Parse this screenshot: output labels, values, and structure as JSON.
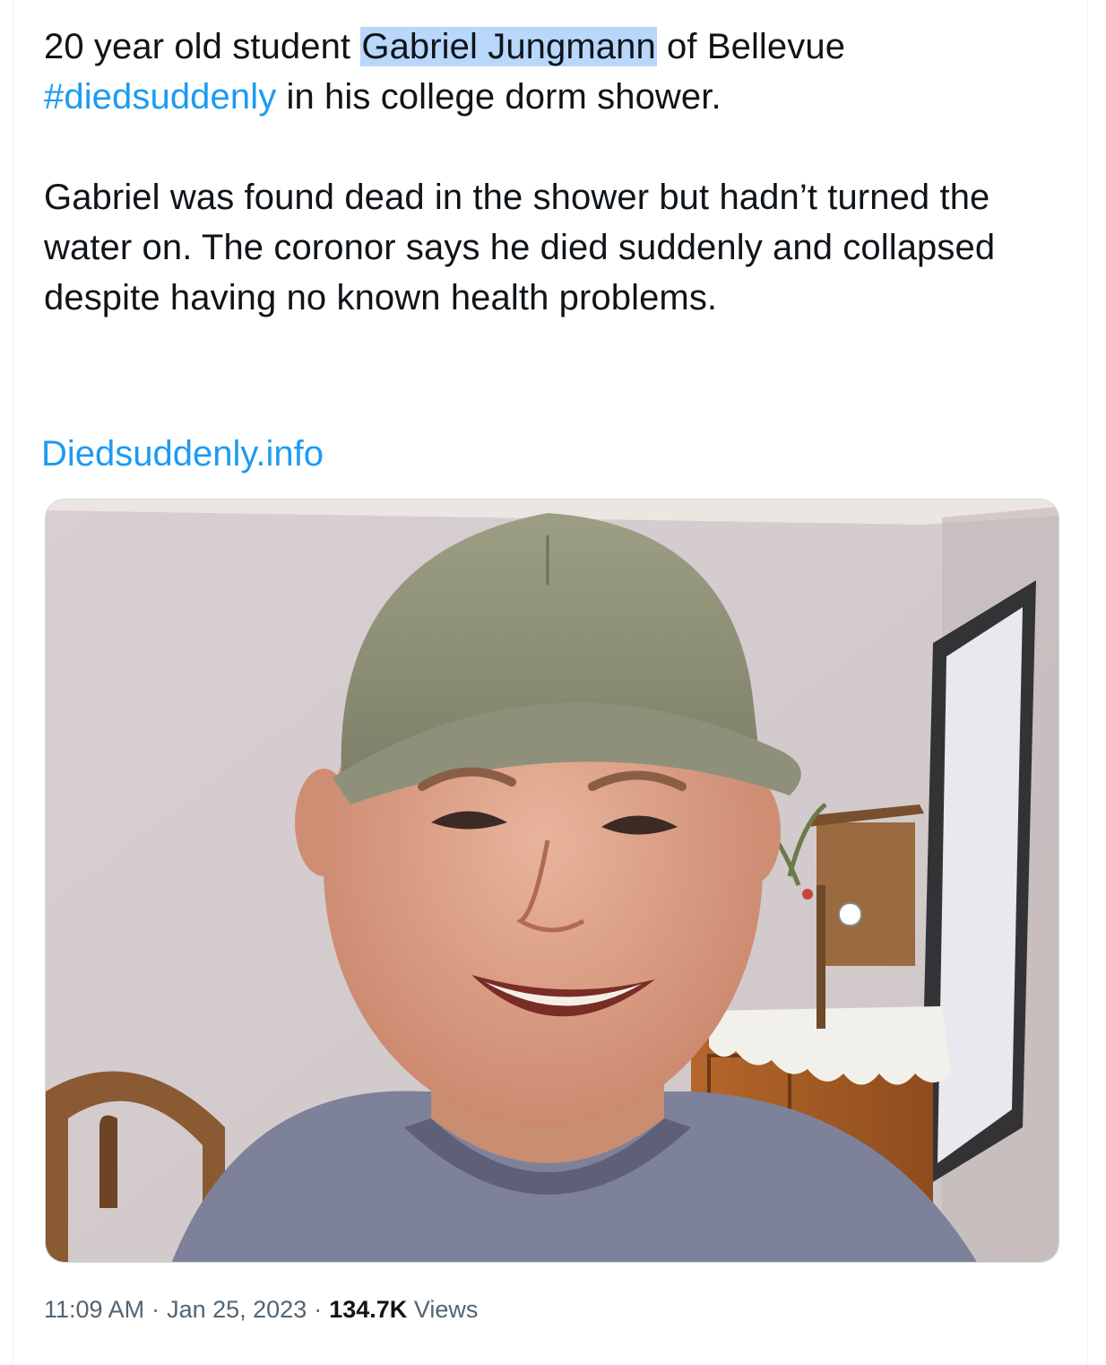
{
  "tweet": {
    "line1_pre": "20 year old student ",
    "line1_highlight": "Gabriel Jungmann",
    "line1_post": " of Bellevue",
    "hashtag": "#diedsuddenly",
    "line2_post": " in his college dorm shower.",
    "paragraph2": "Gabriel was found dead in the shower but hadn’t turned the water on. The coronor says he died suddenly and collapsed despite having no known health problems.",
    "link": "Diedsuddenly.info"
  },
  "media": {
    "subject": "photo-of-young-man-in-green-cap"
  },
  "meta": {
    "time": "11:09 AM",
    "date": "Jan 25, 2023",
    "separator": "·",
    "views_count": "134.7K",
    "views_label": "Views"
  },
  "colors": {
    "link": "#1d9bf0",
    "highlight": "#b8d7fb",
    "text": "#0f1419",
    "muted": "#536471",
    "border": "#cfd9de"
  }
}
